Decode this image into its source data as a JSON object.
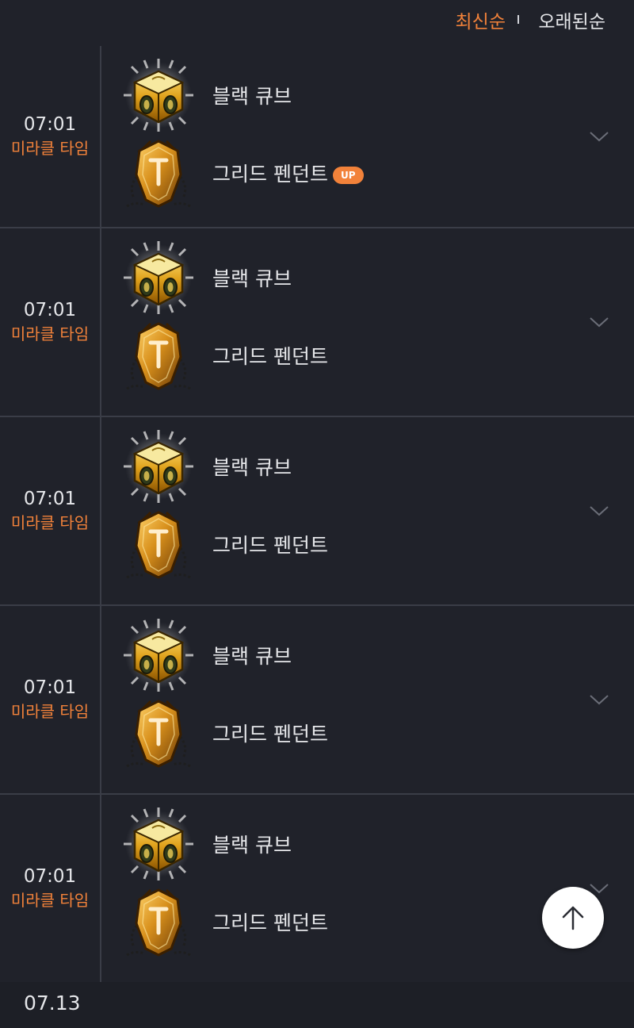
{
  "sort": {
    "newest_label": "최신순",
    "oldest_label": "오래된순",
    "active": "newest"
  },
  "colors": {
    "accent": "#f2823a",
    "background": "#20222a",
    "divider": "#3a3d47"
  },
  "entries": [
    {
      "time": "07:01",
      "event": "미라클 타임",
      "items": [
        {
          "name": "블랙 큐브",
          "icon": "black-cube-icon",
          "badge": ""
        },
        {
          "name": "그리드 펜던트",
          "icon": "greed-pendant-icon",
          "badge": "UP"
        }
      ]
    },
    {
      "time": "07:01",
      "event": "미라클 타임",
      "items": [
        {
          "name": "블랙 큐브",
          "icon": "black-cube-icon",
          "badge": ""
        },
        {
          "name": "그리드 펜던트",
          "icon": "greed-pendant-icon",
          "badge": ""
        }
      ]
    },
    {
      "time": "07:01",
      "event": "미라클 타임",
      "items": [
        {
          "name": "블랙 큐브",
          "icon": "black-cube-icon",
          "badge": ""
        },
        {
          "name": "그리드 펜던트",
          "icon": "greed-pendant-icon",
          "badge": ""
        }
      ]
    },
    {
      "time": "07:01",
      "event": "미라클 타임",
      "items": [
        {
          "name": "블랙 큐브",
          "icon": "black-cube-icon",
          "badge": ""
        },
        {
          "name": "그리드 펜던트",
          "icon": "greed-pendant-icon",
          "badge": ""
        }
      ]
    },
    {
      "time": "07:01",
      "event": "미라클 타임",
      "items": [
        {
          "name": "블랙 큐브",
          "icon": "black-cube-icon",
          "badge": ""
        },
        {
          "name": "그리드 펜던트",
          "icon": "greed-pendant-icon",
          "badge": ""
        }
      ]
    }
  ],
  "next_date": "07.13",
  "scroll_top_icon": "arrow-up-icon"
}
